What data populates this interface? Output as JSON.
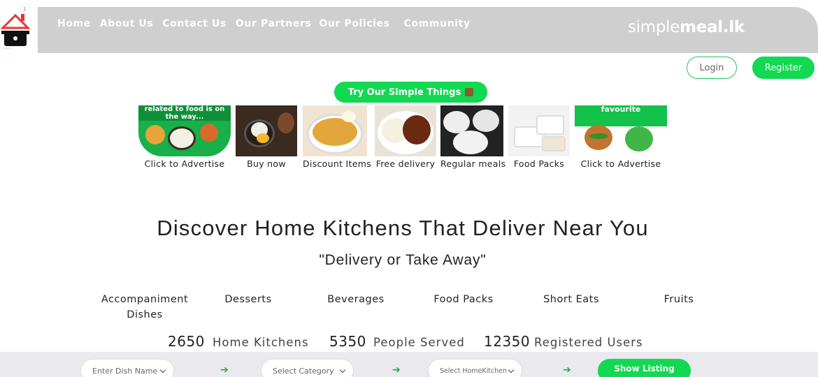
{
  "nav": {
    "items": [
      "Home",
      "About Us",
      "Contact Us",
      "Our Partners",
      "Our Policies",
      "Community"
    ],
    "brand_part1": "simple",
    "brand_part2": "meal.lk"
  },
  "auth": {
    "login": "Login",
    "register": "Register"
  },
  "promo": {
    "try_label": "Try Our Simple Things"
  },
  "tiles": [
    {
      "label": "Click to Advertise",
      "banner": "related to food is on the way..."
    },
    {
      "label": "Buy now"
    },
    {
      "label": "Discount Items"
    },
    {
      "label": "Free delivery"
    },
    {
      "label": "Regular meals"
    },
    {
      "label": "Food Packs"
    },
    {
      "label": "Click to Advertise",
      "banner": "favourite"
    }
  ],
  "hero": {
    "title": "Discover Home Kitchens That Deliver Near You",
    "subtitle": "\"Delivery or Take Away\""
  },
  "categories": [
    "Accompaniment Dishes",
    "Desserts",
    "Beverages",
    "Food Packs",
    "Short Eats",
    "Fruits"
  ],
  "stats": [
    {
      "value": "2650",
      "label": "Home Kitchens"
    },
    {
      "value": "5350",
      "label": "People Served"
    },
    {
      "value": "12350",
      "label": "Registered Users"
    }
  ],
  "filters": {
    "dish_placeholder": "Enter Dish Name",
    "category_placeholder": "Select Category",
    "kitchen_placeholder": "Select HomeKitchen",
    "arrow": "➔",
    "show_listing": "Show Listing"
  },
  "colors": {
    "accent": "#12d852",
    "navbar": "#cfcfcf"
  }
}
